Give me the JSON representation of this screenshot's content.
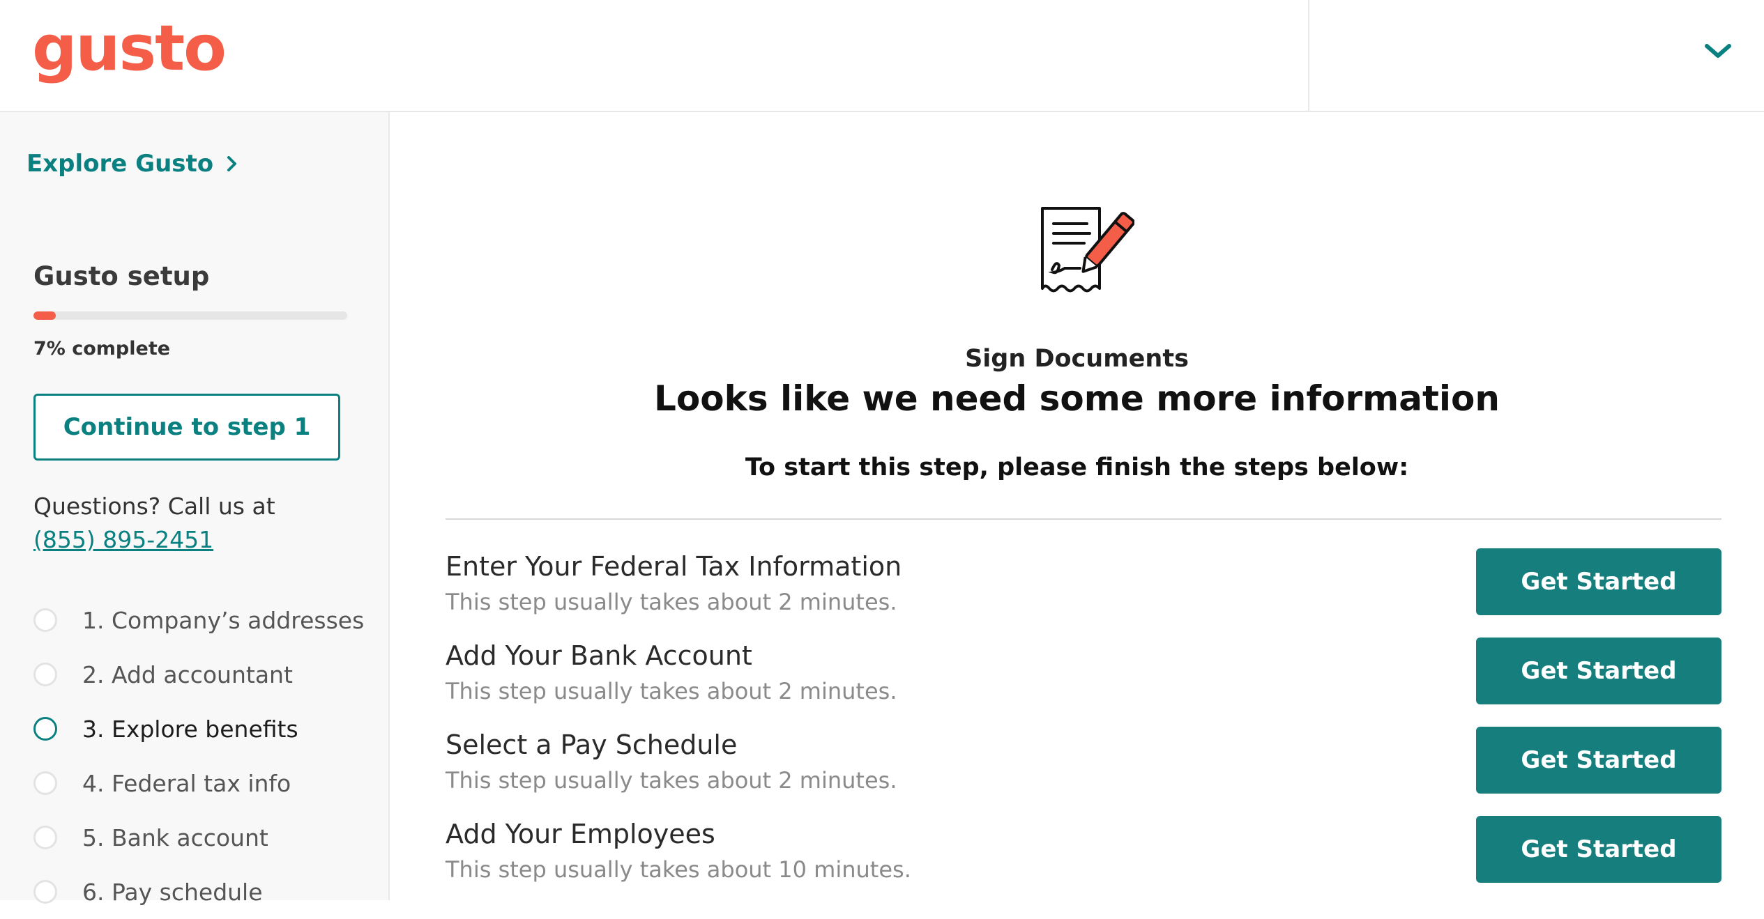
{
  "header": {
    "logo_text": "gusto"
  },
  "sidebar": {
    "explore_label": "Explore Gusto",
    "setup_title": "Gusto setup",
    "progress_percent": 7,
    "progress_label": "7% complete",
    "continue_label": "Continue to step 1",
    "questions_text": "Questions? Call us at",
    "phone": "(855) 895-2451",
    "steps": [
      {
        "label": "1. Company’s addresses",
        "active": false
      },
      {
        "label": "2. Add accountant",
        "active": false
      },
      {
        "label": "3. Explore benefits",
        "active": true
      },
      {
        "label": "4. Federal tax info",
        "active": false
      },
      {
        "label": "5. Bank account",
        "active": false
      },
      {
        "label": "6. Pay schedule",
        "active": false
      }
    ]
  },
  "main": {
    "eyebrow": "Sign Documents",
    "heading": "Looks like we need some more information",
    "subheading": "To start this step, please finish the steps below:",
    "tasks": [
      {
        "title": "Enter Your Federal Tax Information",
        "desc": "This step usually takes about 2 minutes.",
        "button": "Get Started"
      },
      {
        "title": "Add Your Bank Account",
        "desc": "This step usually takes about 2 minutes.",
        "button": "Get Started"
      },
      {
        "title": "Select a Pay Schedule",
        "desc": "This step usually takes about 2 minutes.",
        "button": "Get Started"
      },
      {
        "title": "Add Your Employees",
        "desc": "This step usually takes about 10 minutes.",
        "button": "Get Started"
      }
    ]
  },
  "colors": {
    "brand": "#f45d48",
    "accent": "#0a8080",
    "button": "#167f7d"
  },
  "icons": {
    "account_menu": "chevron-down-icon",
    "explore": "chevron-right-icon",
    "document": "document-sign-icon"
  }
}
